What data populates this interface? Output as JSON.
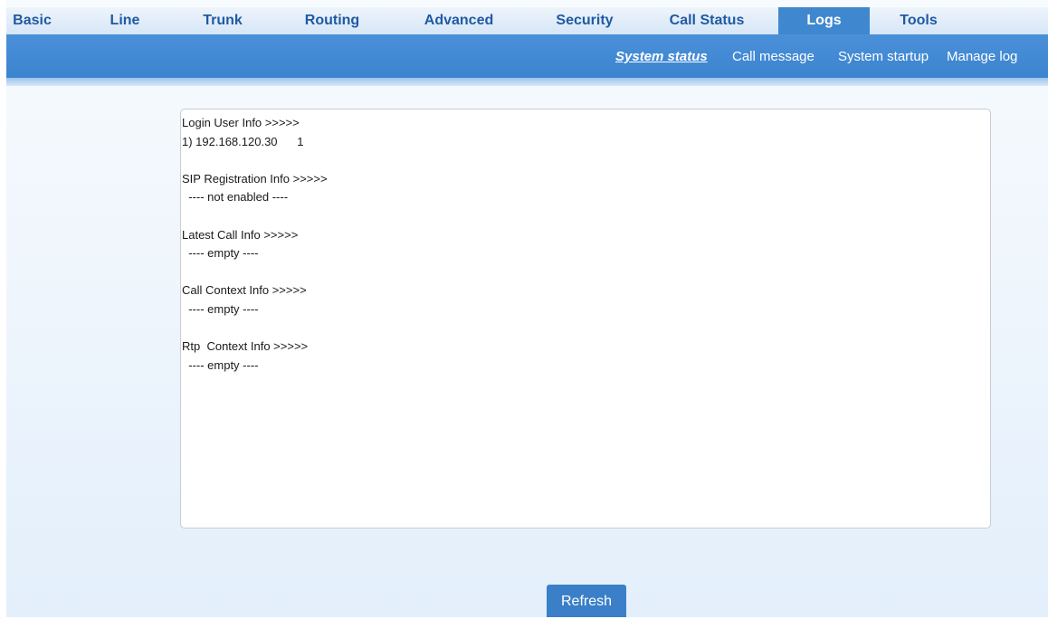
{
  "topnav": {
    "tabs": [
      {
        "label": "Basic"
      },
      {
        "label": "Line"
      },
      {
        "label": "Trunk"
      },
      {
        "label": "Routing"
      },
      {
        "label": "Advanced"
      },
      {
        "label": "Security"
      },
      {
        "label": "Call Status"
      },
      {
        "label": "Logs",
        "active": true
      },
      {
        "label": "Tools"
      }
    ]
  },
  "subnav": {
    "items": [
      {
        "label": "System status",
        "active": true
      },
      {
        "label": "Call message"
      },
      {
        "label": "System startup"
      },
      {
        "label": "Manage log"
      }
    ]
  },
  "log": {
    "lines": [
      "Login User Info >>>>>",
      "1) 192.168.120.30      1",
      "",
      "SIP Registration Info >>>>>",
      "  ---- not enabled ----",
      "",
      "Latest Call Info >>>>>",
      "  ---- empty ----",
      "",
      "Call Context Info >>>>>",
      "  ---- empty ----",
      "",
      "Rtp  Context Info >>>>>",
      "  ---- empty ----"
    ]
  },
  "actions": {
    "refresh_label": "Refresh"
  },
  "colors": {
    "nav_text": "#1f5aa3",
    "active_tab_bg": "#3f88cf",
    "subbar_bg": "#4a90d9",
    "button_bg": "#3a7fc8"
  }
}
